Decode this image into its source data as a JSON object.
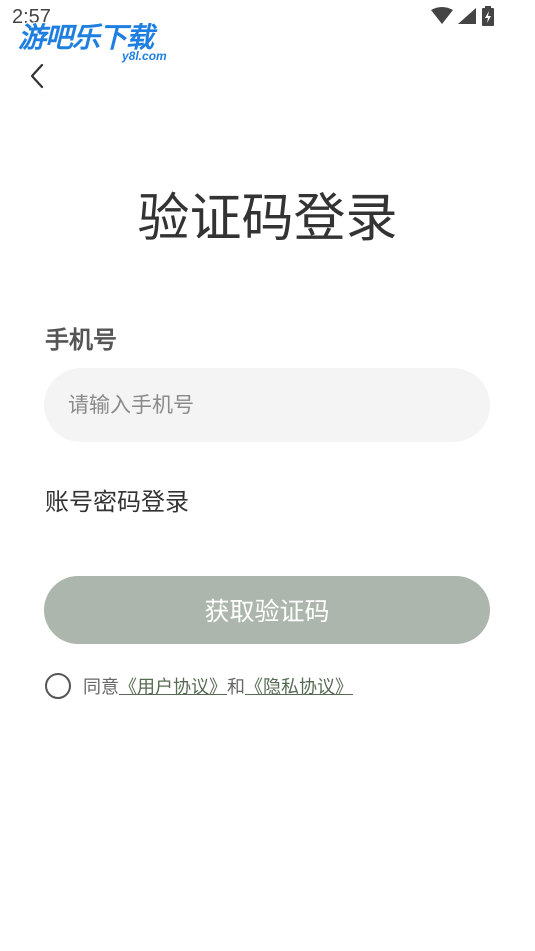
{
  "status_bar": {
    "time": "2:57",
    "icons": [
      "wifi-icon",
      "signal-icon",
      "battery-charging-icon"
    ]
  },
  "watermark": {
    "text": "游吧乐下载",
    "sub": "y8l.com"
  },
  "header": {
    "back_icon": "chevron-left-icon",
    "title": "验证码登录"
  },
  "form": {
    "phone_label": "手机号",
    "phone_placeholder": "请输入手机号",
    "phone_value": "",
    "password_login_label": "账号密码登录",
    "get_code_label": "获取验证码"
  },
  "agreement": {
    "checked": false,
    "prefix": "同意",
    "user_agreement": "《用户协议》",
    "connector": "和",
    "privacy_policy": "《隐私协议》"
  },
  "colors": {
    "button_disabled": "#adb6ad",
    "link": "#566b52",
    "input_bg": "#f4f4f4"
  }
}
